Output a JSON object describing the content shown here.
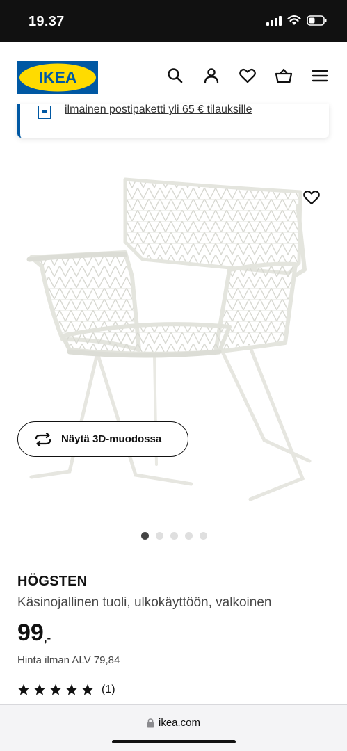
{
  "status_bar": {
    "time": "19.37",
    "icons": [
      "signal-icon",
      "wifi-icon",
      "battery-icon"
    ]
  },
  "header": {
    "logo_text": "IKEA",
    "icons": [
      "search-icon",
      "user-icon",
      "heart-icon",
      "basket-icon",
      "menu-icon"
    ]
  },
  "notice": {
    "text": "ilmainen postipaketti yli 65 € tilauksille"
  },
  "product": {
    "image_alt": "HÖGSTEN chair",
    "view3d_label": "Näytä 3D-muodossa",
    "image_count": 5,
    "active_image": 1,
    "name": "HÖGSTEN",
    "description": "Käsinojallinen tuoli, ulkokäyttöön, valkoinen",
    "price_integer": "99",
    "price_suffix": ",-",
    "price_vat": "Hinta ilman ALV 79,84",
    "rating_stars": 5,
    "rating_count": "(1)"
  },
  "browser": {
    "url": "ikea.com"
  },
  "colors": {
    "ikea_blue": "#0058a3",
    "ikea_yellow": "#ffdb00"
  }
}
